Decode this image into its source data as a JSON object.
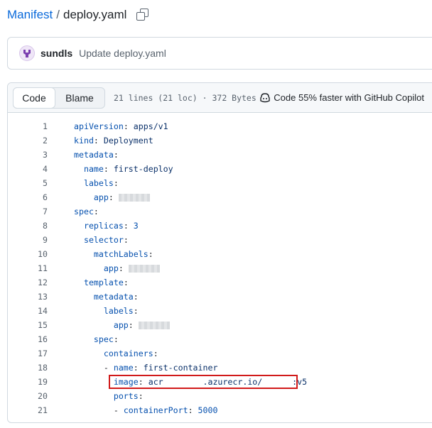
{
  "breadcrumb": {
    "repo": "Manifest",
    "separator": "/",
    "file": "deploy.yaml",
    "copy_icon": "copy-icon"
  },
  "commit": {
    "author": "sundls",
    "message": "Update deploy.yaml",
    "avatar_icon": "user-avatar"
  },
  "file_header": {
    "code_tab": "Code",
    "blame_tab": "Blame",
    "info": "21 lines (21 loc) · 372 Bytes",
    "copilot": "Code 55% faster with GitHub Copilot",
    "copilot_icon": "copilot-icon"
  },
  "code": {
    "lines": [
      {
        "n": "1",
        "indent": "",
        "key": "apiVersion",
        "value": "apps/v1"
      },
      {
        "n": "2",
        "indent": "",
        "key": "kind",
        "value": "Deployment"
      },
      {
        "n": "3",
        "indent": "",
        "key": "metadata",
        "value": ""
      },
      {
        "n": "4",
        "indent": "  ",
        "key": "name",
        "value": "first-deploy"
      },
      {
        "n": "5",
        "indent": "  ",
        "key": "labels",
        "value": ""
      },
      {
        "n": "6",
        "indent": "    ",
        "key": "app",
        "value": ""
      },
      {
        "n": "7",
        "indent": "",
        "key": "spec",
        "value": ""
      },
      {
        "n": "8",
        "indent": "  ",
        "key": "replicas",
        "value": "3"
      },
      {
        "n": "9",
        "indent": "  ",
        "key": "selector",
        "value": ""
      },
      {
        "n": "10",
        "indent": "    ",
        "key": "matchLabels",
        "value": ""
      },
      {
        "n": "11",
        "indent": "      ",
        "key": "app",
        "value": ""
      },
      {
        "n": "12",
        "indent": "  ",
        "key": "template",
        "value": ""
      },
      {
        "n": "13",
        "indent": "    ",
        "key": "metadata",
        "value": ""
      },
      {
        "n": "14",
        "indent": "      ",
        "key": "labels",
        "value": ""
      },
      {
        "n": "15",
        "indent": "        ",
        "key": "app",
        "value": ""
      },
      {
        "n": "16",
        "indent": "    ",
        "key": "spec",
        "value": ""
      },
      {
        "n": "17",
        "indent": "      ",
        "key": "containers",
        "value": ""
      },
      {
        "n": "18",
        "indent": "      - ",
        "key": "name",
        "value": "first-container"
      },
      {
        "n": "19",
        "indent": "        ",
        "key": "image",
        "value": "acr        .azurecr.io/      :v5"
      },
      {
        "n": "20",
        "indent": "        ",
        "key": "ports",
        "value": ""
      },
      {
        "n": "21",
        "indent": "        - ",
        "key": "containerPort",
        "value": "5000"
      }
    ],
    "redacted_lines": [
      "6",
      "11",
      "15"
    ],
    "highlighted_line": "19",
    "highlight_color": "#d11a1a"
  }
}
